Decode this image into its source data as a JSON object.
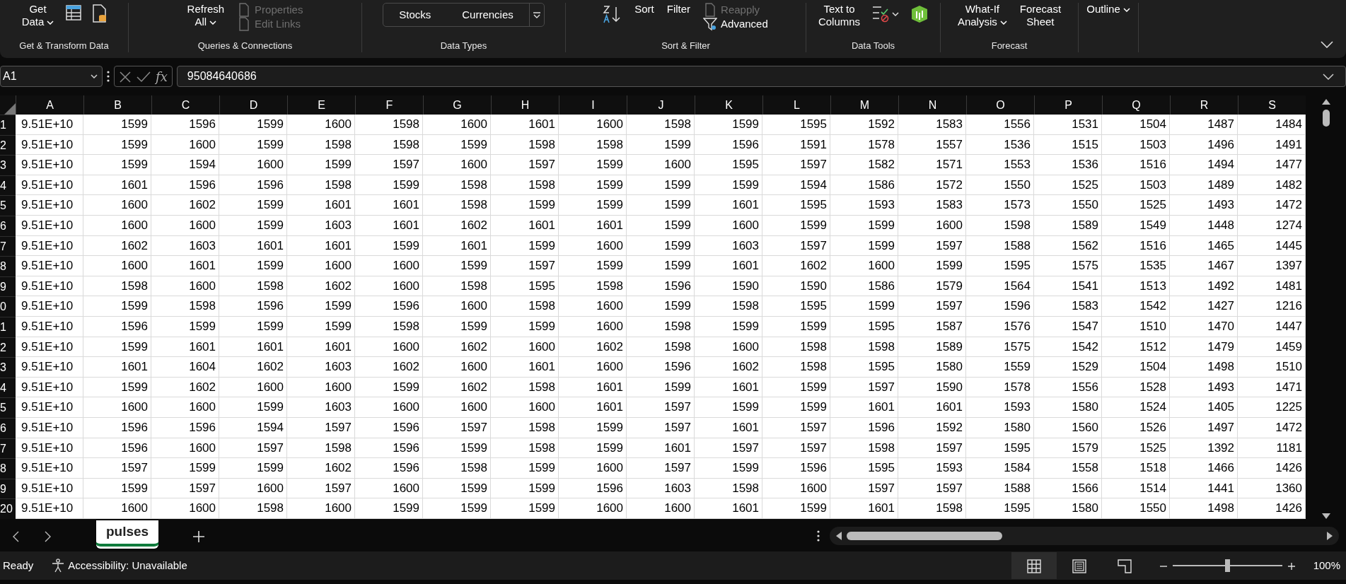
{
  "ribbon": {
    "groups": [
      {
        "caption": "Get & Transform Data",
        "items": [
          {
            "kind": "big",
            "lines": [
              "Get",
              "Data"
            ],
            "dropdown": true
          },
          {
            "kind": "table"
          },
          {
            "kind": "file"
          }
        ]
      },
      {
        "caption": "Queries & Connections",
        "items": [
          {
            "kind": "big",
            "lines": [
              "Refresh",
              "All"
            ],
            "dropdown": true
          },
          {
            "kind": "stack",
            "entries": [
              {
                "text": "Properties",
                "disabled": true
              },
              {
                "text": "Edit Links",
                "disabled": true
              }
            ]
          }
        ]
      },
      {
        "caption": "Data Types",
        "items": [
          {
            "kind": "gallery",
            "entries": [
              "Stocks",
              "Currencies"
            ]
          }
        ]
      },
      {
        "caption": "Sort & Filter",
        "items": [
          {
            "kind": "sortaz"
          },
          {
            "kind": "big",
            "lines": [
              "Sort"
            ],
            "dropdown": false
          },
          {
            "kind": "big",
            "lines": [
              "Filter"
            ],
            "dropdown": false
          },
          {
            "kind": "stack",
            "entries": [
              {
                "text": "Reapply",
                "disabled": true
              },
              {
                "text": "Advanced",
                "disabled": false
              }
            ]
          }
        ]
      },
      {
        "caption": "Data Tools",
        "items": [
          {
            "kind": "big",
            "lines": [
              "Text to",
              "Columns"
            ],
            "dropdown": false
          },
          {
            "kind": "validate"
          },
          {
            "kind": "datamodel"
          }
        ]
      },
      {
        "caption": "Forecast",
        "items": [
          {
            "kind": "big",
            "lines": [
              "What-If",
              "Analysis"
            ],
            "dropdown": true
          },
          {
            "kind": "big",
            "lines": [
              "Forecast",
              "Sheet"
            ],
            "dropdown": false
          }
        ]
      },
      {
        "items": [
          {
            "kind": "big",
            "lines": [
              "Outline"
            ],
            "dropdown": true
          }
        ]
      }
    ]
  },
  "formula_bar": {
    "name_box": "A1",
    "function_label": "fx",
    "value": "95084640686"
  },
  "columns": [
    "A",
    "B",
    "C",
    "D",
    "E",
    "F",
    "G",
    "H",
    "I",
    "J",
    "K",
    "L",
    "M",
    "N",
    "O",
    "P",
    "Q",
    "R",
    "S"
  ],
  "rows": [
    {
      "header": "1",
      "cells": [
        "9.51E+10",
        "1599",
        "1596",
        "1599",
        "1600",
        "1598",
        "1600",
        "1601",
        "1600",
        "1598",
        "1599",
        "1595",
        "1592",
        "1583",
        "1556",
        "1531",
        "1504",
        "1487",
        "1484"
      ]
    },
    {
      "header": "2",
      "cells": [
        "9.51E+10",
        "1599",
        "1600",
        "1599",
        "1598",
        "1598",
        "1599",
        "1598",
        "1598",
        "1599",
        "1596",
        "1591",
        "1578",
        "1557",
        "1536",
        "1515",
        "1503",
        "1496",
        "1491"
      ]
    },
    {
      "header": "3",
      "cells": [
        "9.51E+10",
        "1599",
        "1594",
        "1600",
        "1599",
        "1597",
        "1600",
        "1597",
        "1599",
        "1600",
        "1595",
        "1597",
        "1582",
        "1571",
        "1553",
        "1536",
        "1516",
        "1494",
        "1477"
      ]
    },
    {
      "header": "4",
      "cells": [
        "9.51E+10",
        "1601",
        "1596",
        "1596",
        "1598",
        "1599",
        "1598",
        "1598",
        "1599",
        "1599",
        "1599",
        "1594",
        "1586",
        "1572",
        "1550",
        "1525",
        "1503",
        "1489",
        "1482"
      ]
    },
    {
      "header": "5",
      "cells": [
        "9.51E+10",
        "1600",
        "1602",
        "1599",
        "1601",
        "1601",
        "1598",
        "1599",
        "1599",
        "1599",
        "1601",
        "1595",
        "1593",
        "1583",
        "1573",
        "1550",
        "1525",
        "1493",
        "1472"
      ]
    },
    {
      "header": "6",
      "cells": [
        "9.51E+10",
        "1600",
        "1600",
        "1599",
        "1603",
        "1601",
        "1602",
        "1601",
        "1601",
        "1599",
        "1600",
        "1599",
        "1599",
        "1600",
        "1598",
        "1589",
        "1549",
        "1448",
        "1274"
      ]
    },
    {
      "header": "7",
      "cells": [
        "9.51E+10",
        "1602",
        "1603",
        "1601",
        "1601",
        "1599",
        "1601",
        "1599",
        "1600",
        "1599",
        "1603",
        "1597",
        "1599",
        "1597",
        "1588",
        "1562",
        "1516",
        "1465",
        "1445"
      ]
    },
    {
      "header": "8",
      "cells": [
        "9.51E+10",
        "1600",
        "1601",
        "1599",
        "1600",
        "1600",
        "1599",
        "1597",
        "1599",
        "1599",
        "1601",
        "1602",
        "1600",
        "1599",
        "1595",
        "1575",
        "1535",
        "1467",
        "1397"
      ]
    },
    {
      "header": "9",
      "cells": [
        "9.51E+10",
        "1598",
        "1600",
        "1598",
        "1602",
        "1600",
        "1598",
        "1595",
        "1598",
        "1596",
        "1590",
        "1590",
        "1586",
        "1579",
        "1564",
        "1541",
        "1513",
        "1492",
        "1481"
      ]
    },
    {
      "header": "0",
      "cells": [
        "9.51E+10",
        "1599",
        "1598",
        "1596",
        "1599",
        "1596",
        "1600",
        "1598",
        "1600",
        "1599",
        "1598",
        "1595",
        "1599",
        "1597",
        "1596",
        "1583",
        "1542",
        "1427",
        "1216"
      ]
    },
    {
      "header": "1",
      "cells": [
        "9.51E+10",
        "1596",
        "1599",
        "1599",
        "1599",
        "1598",
        "1599",
        "1599",
        "1600",
        "1598",
        "1599",
        "1599",
        "1595",
        "1587",
        "1576",
        "1547",
        "1510",
        "1470",
        "1447"
      ]
    },
    {
      "header": "2",
      "cells": [
        "9.51E+10",
        "1599",
        "1601",
        "1601",
        "1601",
        "1600",
        "1602",
        "1600",
        "1602",
        "1598",
        "1600",
        "1598",
        "1598",
        "1589",
        "1575",
        "1542",
        "1512",
        "1479",
        "1459"
      ]
    },
    {
      "header": "3",
      "cells": [
        "9.51E+10",
        "1601",
        "1604",
        "1602",
        "1603",
        "1602",
        "1600",
        "1601",
        "1600",
        "1596",
        "1602",
        "1598",
        "1595",
        "1580",
        "1559",
        "1529",
        "1504",
        "1498",
        "1510"
      ]
    },
    {
      "header": "4",
      "cells": [
        "9.51E+10",
        "1599",
        "1602",
        "1600",
        "1600",
        "1599",
        "1602",
        "1598",
        "1601",
        "1599",
        "1601",
        "1599",
        "1597",
        "1590",
        "1578",
        "1556",
        "1528",
        "1493",
        "1471"
      ]
    },
    {
      "header": "5",
      "cells": [
        "9.51E+10",
        "1600",
        "1600",
        "1599",
        "1603",
        "1600",
        "1600",
        "1600",
        "1601",
        "1597",
        "1599",
        "1599",
        "1601",
        "1601",
        "1593",
        "1580",
        "1524",
        "1405",
        "1225"
      ]
    },
    {
      "header": "6",
      "cells": [
        "9.51E+10",
        "1596",
        "1596",
        "1594",
        "1597",
        "1596",
        "1597",
        "1598",
        "1599",
        "1597",
        "1601",
        "1597",
        "1596",
        "1592",
        "1580",
        "1560",
        "1526",
        "1497",
        "1472"
      ]
    },
    {
      "header": "7",
      "cells": [
        "9.51E+10",
        "1596",
        "1600",
        "1597",
        "1598",
        "1596",
        "1599",
        "1598",
        "1599",
        "1601",
        "1597",
        "1597",
        "1598",
        "1597",
        "1595",
        "1579",
        "1525",
        "1392",
        "1181"
      ]
    },
    {
      "header": "8",
      "cells": [
        "9.51E+10",
        "1597",
        "1599",
        "1599",
        "1602",
        "1596",
        "1598",
        "1599",
        "1600",
        "1597",
        "1599",
        "1596",
        "1595",
        "1593",
        "1584",
        "1558",
        "1518",
        "1466",
        "1426"
      ]
    },
    {
      "header": "9",
      "cells": [
        "9.51E+10",
        "1599",
        "1597",
        "1600",
        "1597",
        "1600",
        "1599",
        "1599",
        "1596",
        "1603",
        "1598",
        "1600",
        "1597",
        "1597",
        "1588",
        "1566",
        "1514",
        "1441",
        "1360"
      ]
    },
    {
      "header": "20",
      "cells": [
        "9.51E+10",
        "1600",
        "1600",
        "1598",
        "1600",
        "1599",
        "1599",
        "1599",
        "1600",
        "1600",
        "1601",
        "1599",
        "1601",
        "1598",
        "1595",
        "1580",
        "1550",
        "1498",
        "1426"
      ]
    }
  ],
  "sheet_tabs": [
    {
      "label": "pulses",
      "selected": true
    }
  ],
  "status_bar": {
    "mode": "Ready",
    "accessibility": "Accessibility: Unavailable",
    "views": [
      {
        "kind": "normal",
        "selected": true
      },
      {
        "kind": "layout",
        "selected": false
      },
      {
        "kind": "pagebreak",
        "selected": false
      }
    ],
    "zoom": {
      "level": 0.5,
      "reading": "100%"
    }
  }
}
